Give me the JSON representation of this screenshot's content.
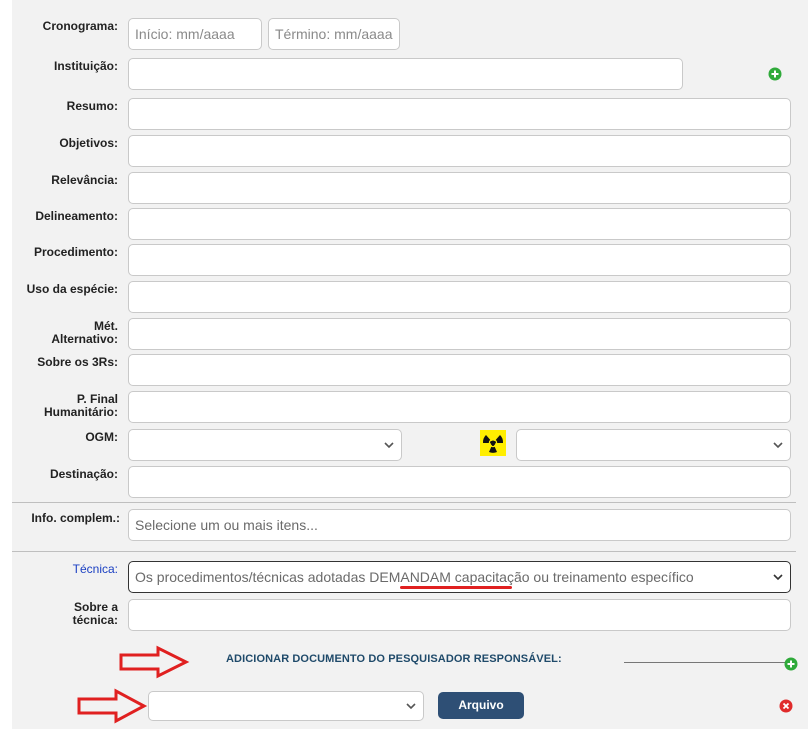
{
  "form": {
    "cronograma": {
      "label": "Cronograma:",
      "start_placeholder": "Início: mm/aaaa",
      "end_placeholder": "Término: mm/aaaa"
    },
    "instituicao": {
      "label": "Instituição:"
    },
    "resumo": {
      "label": "Resumo:"
    },
    "objetivos": {
      "label": "Objetivos:"
    },
    "relevancia": {
      "label": "Relevância:"
    },
    "delineamento": {
      "label": "Delineamento:"
    },
    "procedimento": {
      "label": "Procedimento:"
    },
    "uso_especie": {
      "label": "Uso da espécie:"
    },
    "met_alternativo": {
      "label_line1": "Mét.",
      "label_line2": "Alternativo:"
    },
    "sobre_3rs": {
      "label": "Sobre os 3Rs:"
    },
    "p_final": {
      "label_line1": "P. Final",
      "label_line2": "Humanitário:"
    },
    "ogm": {
      "label": "OGM:"
    },
    "destinacao": {
      "label": "Destinação:"
    },
    "info_complem": {
      "label": "Info. complem.:",
      "placeholder": "Selecione um ou mais itens..."
    },
    "tecnica": {
      "label": "Técnica:",
      "value": "Os procedimentos/técnicas adotadas DEMANDAM capacitação ou treinamento específico"
    },
    "sobre_tecnica": {
      "label_line1": "Sobre a",
      "label_line2": "técnica:"
    }
  },
  "documents": {
    "heading": "ADICIONAR DOCUMENTO DO PESQUISADOR RESPONSÁVEL:",
    "file_button": "Arquivo"
  },
  "colors": {
    "accent": "#2e4f75",
    "add": "#2faa3a",
    "remove": "#e02b2b",
    "annotation": "#e02020",
    "hazard": "#ffee00"
  }
}
